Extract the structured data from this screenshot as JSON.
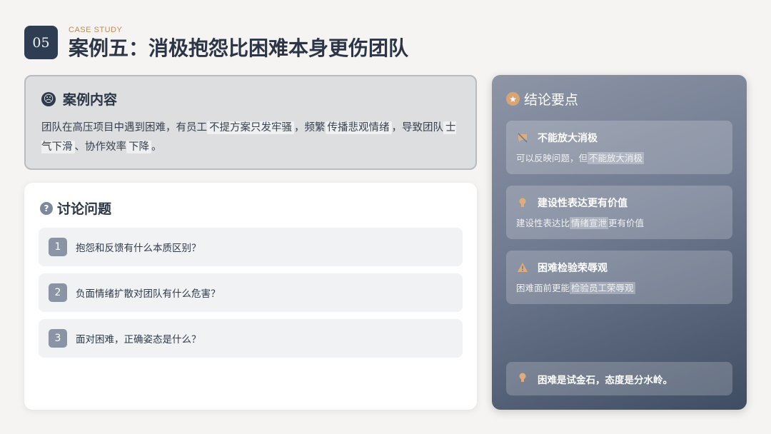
{
  "header": {
    "number": "05",
    "kicker": "CASE STUDY",
    "title": "案例五：消极抱怨比困难本身更伤团队"
  },
  "case": {
    "heading": "案例内容",
    "icon": "sad-face-icon",
    "text": {
      "p1": "团队在高压项目中遇到困难，有员工",
      "h1": "不提方案只发牢骚",
      "p2": "，频繁",
      "h2": "传播悲观情绪",
      "p3": "，导致团队",
      "h3": "士气下滑",
      "p4": "、协作效率",
      "h4": "下降",
      "p5": "。"
    }
  },
  "discussion": {
    "heading": "讨论问题",
    "icon": "question-icon",
    "questions": [
      {
        "num": "1",
        "text": "抱怨和反馈有什么本质区别？"
      },
      {
        "num": "2",
        "text": "负面情绪扩散对团队有什么危害？"
      },
      {
        "num": "3",
        "text": "面对困难，正确姿态是什么？"
      }
    ]
  },
  "conclusion": {
    "heading": "结论要点",
    "icon": "star-icon",
    "points": [
      {
        "icon": "no-comment-icon",
        "title": "不能放大消极",
        "desc_plain": "可以反映问题，但",
        "desc_hl": "不能放大消极",
        "desc_tail": ""
      },
      {
        "icon": "lightbulb-icon",
        "title": "建设性表达更有价值",
        "desc_plain": "建设性表达比",
        "desc_hl": "情绪宣泄",
        "desc_tail": "更有价值"
      },
      {
        "icon": "warning-icon",
        "title": "困难检验荣辱观",
        "desc_plain": "困难面前更能",
        "desc_hl": "检验员工荣辱观",
        "desc_tail": ""
      }
    ],
    "quote": {
      "icon": "lightbulb-icon",
      "text": "困难是试金石，态度是分水岭。"
    }
  },
  "colors": {
    "badge": "#2e3d52",
    "accent": "#c48a56",
    "panel_top": "#8d95a6",
    "panel_bottom": "#3f4d63"
  }
}
